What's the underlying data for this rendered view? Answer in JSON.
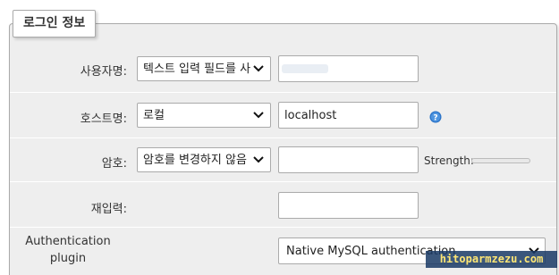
{
  "legend": {
    "title": "로그인 정보"
  },
  "rows": {
    "username": {
      "label": "사용자명:",
      "select_value": "텍스트 입력 필드를 사용:",
      "input_value": ""
    },
    "host": {
      "label": "호스트명:",
      "select_value": "로컬",
      "input_value": "localhost"
    },
    "password": {
      "label": "암호:",
      "select_value": "암호를 변경하지 않음",
      "input_value": "",
      "strength_label": "Strength:"
    },
    "retype": {
      "label": "재입력:",
      "input_value": ""
    },
    "auth_plugin": {
      "label_line1": "Authentication",
      "label_line2": "plugin",
      "select_value": "Native MySQL authentication"
    }
  },
  "watermark": {
    "text": "hitoparmzezu.com"
  },
  "colors": {
    "fieldset_bg": "#eeeeee",
    "help_icon": "#2a73c8",
    "border": "#aaaaaa"
  }
}
